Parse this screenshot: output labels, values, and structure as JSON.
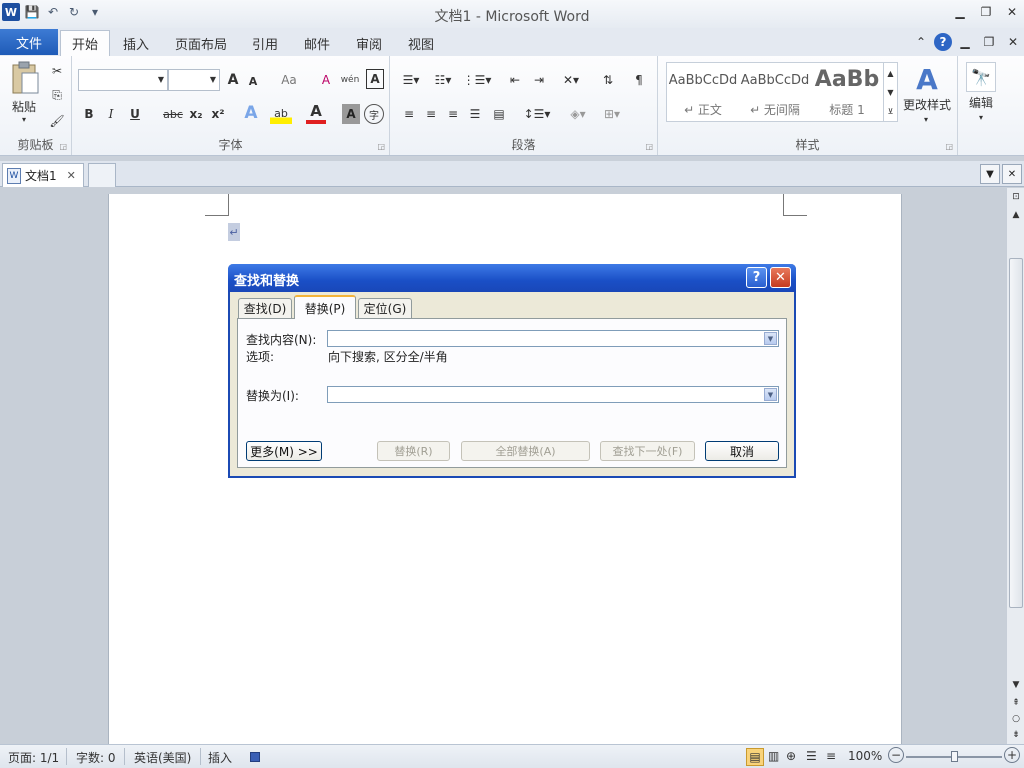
{
  "window": {
    "title": "文档1 - Microsoft Word",
    "app_icon": "W"
  },
  "qat": {
    "save_icon": "💾",
    "undo_icon": "↶",
    "redo_icon": "↻",
    "customize_icon": "▾"
  },
  "ribbon_tabs": {
    "file": "文件",
    "items": [
      "开始",
      "插入",
      "页面布局",
      "引用",
      "邮件",
      "审阅",
      "视图"
    ],
    "active": "开始"
  },
  "clipboard_group": {
    "paste_label": "粘贴",
    "group_label": "剪贴板"
  },
  "font_group": {
    "group_label": "字体",
    "font_name": "",
    "font_size": "",
    "bold": "B",
    "italic": "I",
    "underline": "U",
    "strike": "abc",
    "subscript": "x₂",
    "superscript": "x²",
    "grow": "A",
    "shrink": "A",
    "change_case": "Aa",
    "clear": "A",
    "text_effect": "A",
    "highlight": "ab",
    "font_color": "A",
    "char_shading": "A",
    "enclose": "字",
    "pinyin": "wén",
    "char_border": "A"
  },
  "paragraph_group": {
    "group_label": "段落"
  },
  "styles_group": {
    "group_label": "样式",
    "styles": [
      {
        "preview": "AaBbCcDd",
        "name": "↵ 正文"
      },
      {
        "preview": "AaBbCcDd",
        "name": "↵ 无间隔"
      },
      {
        "preview": "AaBb",
        "name": "标题 1"
      }
    ],
    "change_styles": "更改样式",
    "editing": "编辑"
  },
  "document_tabs": {
    "doc_name": "文档1",
    "close_icon": "✕"
  },
  "document": {
    "paragraph_mark": "↵"
  },
  "dialog": {
    "title": "查找和替换",
    "help_label": "?",
    "close_label": "✕",
    "tabs": [
      "查找(D)",
      "替换(P)",
      "定位(G)"
    ],
    "active_tab": "替换(P)",
    "find_label": "查找内容(N):",
    "find_value": "",
    "options_label": "选项:",
    "options_value": "向下搜索, 区分全/半角",
    "replace_label": "替换为(I):",
    "replace_value": "",
    "buttons": {
      "more": "更多(M) >>",
      "replace": "替换(R)",
      "replace_all": "全部替换(A)",
      "find_next": "查找下一处(F)",
      "cancel": "取消"
    }
  },
  "statusbar": {
    "page": "页面: 1/1",
    "words": "字数: 0",
    "language": "英语(美国)",
    "mode": "插入",
    "zoom": "100%",
    "zoom_minus": "−",
    "zoom_plus": "+"
  }
}
